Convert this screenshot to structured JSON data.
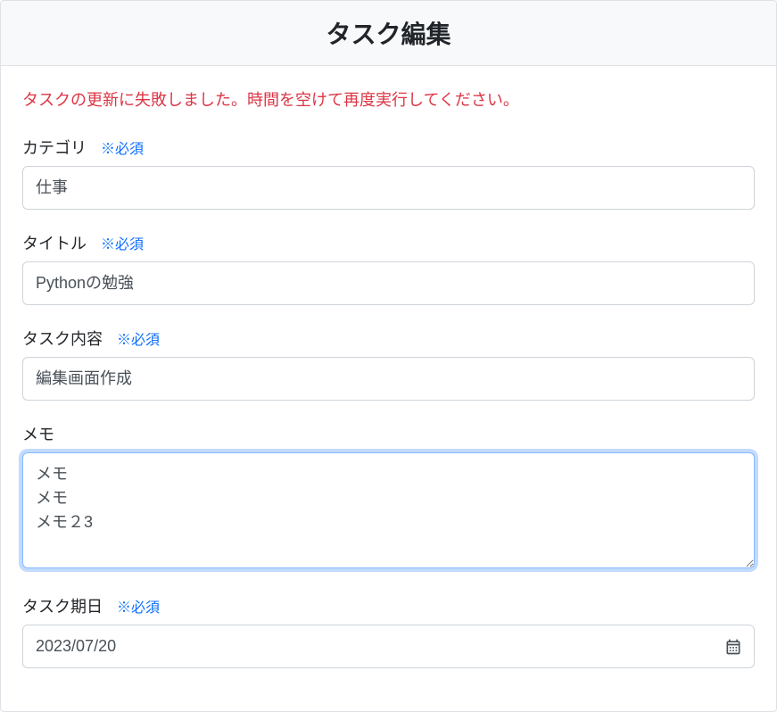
{
  "header": {
    "title": "タスク編集"
  },
  "error": {
    "message": "タスクの更新に失敗しました。時間を空けて再度実行してください。"
  },
  "labels": {
    "required": "※必須"
  },
  "fields": {
    "category": {
      "label": "カテゴリ",
      "value": "仕事"
    },
    "title": {
      "label": "タイトル",
      "value": "Pythonの勉強"
    },
    "content": {
      "label": "タスク内容",
      "value": "編集画面作成"
    },
    "memo": {
      "label": "メモ",
      "value": "メモ\nメモ\nメモ２3"
    },
    "dueDate": {
      "label": "タスク期日",
      "value": "2023/07/20"
    }
  }
}
